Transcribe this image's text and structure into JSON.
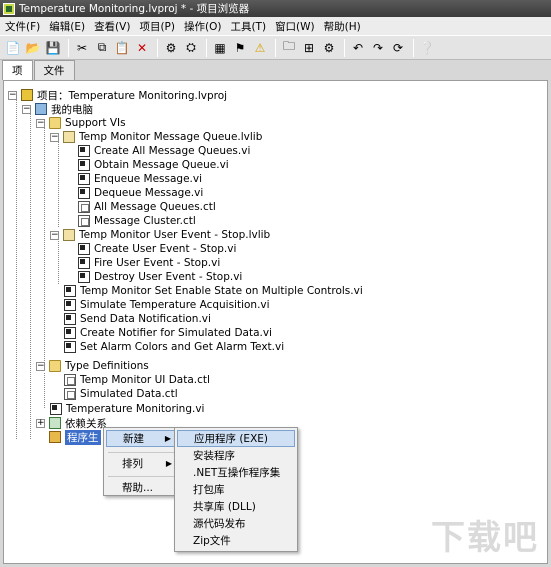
{
  "window": {
    "title": "Temperature Monitoring.lvproj * - 项目浏览器"
  },
  "menubar": {
    "items": [
      "文件(F)",
      "编辑(E)",
      "查看(V)",
      "项目(P)",
      "操作(O)",
      "工具(T)",
      "窗口(W)",
      "帮助(H)"
    ]
  },
  "toolbar": {
    "icons": [
      "new-icon",
      "open-icon",
      "save-all-icon",
      "cut-icon",
      "copy-icon",
      "paste-icon",
      "delete-icon",
      "build-icon",
      "deploy-icon",
      "view-icon",
      "build-spec-icon",
      "warning-icon",
      "folder-icon",
      "add-icon",
      "undo-icon",
      "redo-icon",
      "help-icon"
    ]
  },
  "tabs": [
    {
      "label": "项"
    },
    {
      "label": "文件"
    }
  ],
  "tree": {
    "project": "项目：Temperature Monitoring.lvproj",
    "computer": "我的电脑",
    "support_vis": "Support VIs",
    "lib1": "Temp Monitor Message Queue.lvlib",
    "lib1_items": [
      "Create All Message Queues.vi",
      "Obtain Message Queue.vi",
      "Enqueue Message.vi",
      "Dequeue Message.vi",
      "All Message Queues.ctl",
      "Message Cluster.ctl"
    ],
    "lib2": "Temp Monitor User Event - Stop.lvlib",
    "lib2_items": [
      "Create User Event - Stop.vi",
      "Fire User Event - Stop.vi",
      "Destroy User Event - Stop.vi"
    ],
    "support_items": [
      "Temp Monitor Set Enable State on Multiple Controls.vi",
      "Simulate Temperature Acquisition.vi",
      "Send Data Notification.vi",
      "Create Notifier for Simulated Data.vi",
      "Set Alarm Colors and Get Alarm Text.vi"
    ],
    "type_defs": "Type Definitions",
    "type_items": [
      "Temp Monitor UI Data.ctl",
      "Simulated Data.ctl"
    ],
    "main_vi": "Temperature Monitoring.vi",
    "deps": "依赖关系",
    "build": "程序生"
  },
  "context_menu": {
    "items": [
      "新建",
      "排列",
      "帮助..."
    ]
  },
  "submenu": {
    "items": [
      "应用程序 (EXE)",
      "安装程序",
      ".NET互操作程序集",
      "打包库",
      "共享库 (DLL)",
      "源代码发布",
      "Zip文件"
    ]
  },
  "watermark": "下载吧"
}
